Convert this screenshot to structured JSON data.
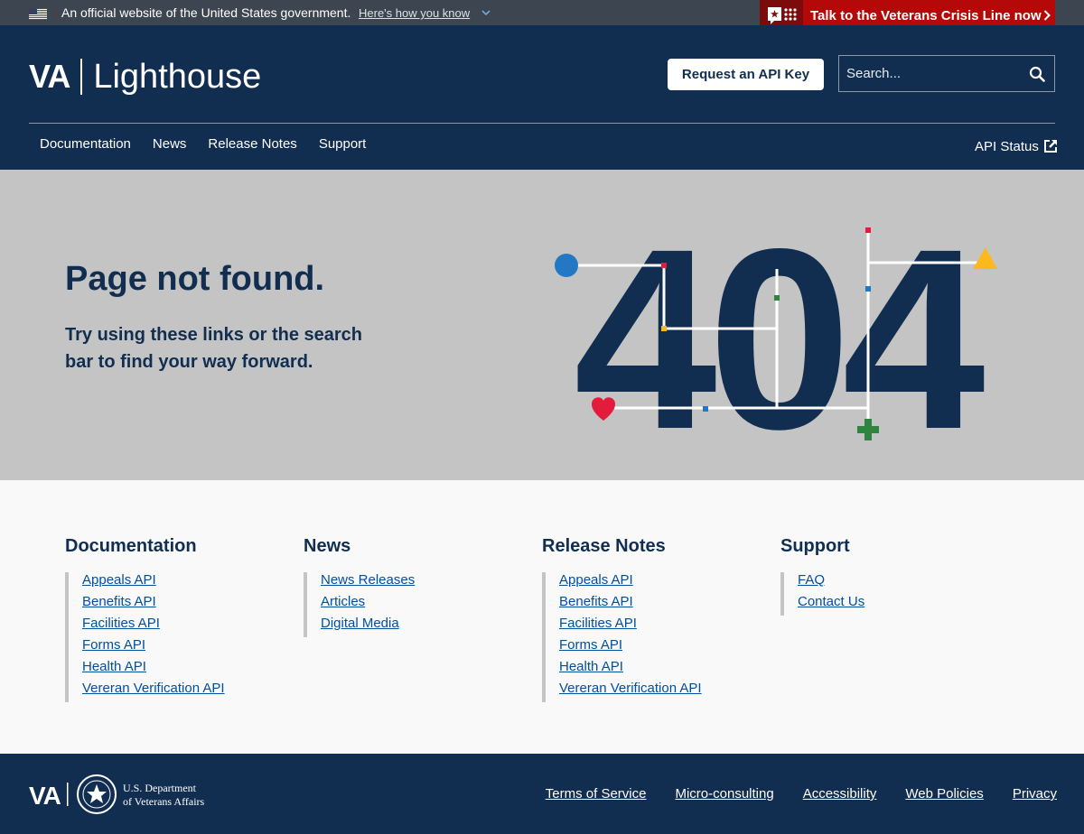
{
  "gov_banner": {
    "text": "An official website of the United States government.",
    "link": "Here's how you know"
  },
  "crisis": {
    "label": "Talk to the Veterans Crisis Line now"
  },
  "header": {
    "logo_va": "VA",
    "logo_name": "Lighthouse",
    "api_key_button": "Request an API Key",
    "search_placeholder": "Search...",
    "nav": [
      "Documentation",
      "News",
      "Release Notes",
      "Support"
    ],
    "api_status": "API Status"
  },
  "hero": {
    "title": "Page not found.",
    "subtitle": "Try using these links or the search bar to find your way forward.",
    "code": "404"
  },
  "footer_columns": [
    {
      "heading": "Documentation",
      "links": [
        "Appeals API",
        "Benefits API",
        "Facilities API",
        "Forms API",
        "Health API",
        "Vereran Verification API"
      ]
    },
    {
      "heading": "News",
      "links": [
        "News Releases",
        "Articles",
        "Digital Media"
      ]
    },
    {
      "heading": "Release Notes",
      "links": [
        "Appeals API",
        "Benefits API",
        "Facilities API",
        "Forms API",
        "Health API",
        "Vereran Verification API"
      ]
    },
    {
      "heading": "Support",
      "links": [
        "FAQ",
        "Contact Us"
      ]
    }
  ],
  "bottom": {
    "logo_va": "VA",
    "dept_line1": "U.S. Department",
    "dept_line2": "of Veterans Affairs",
    "links": [
      "Terms of Service",
      "Micro-consulting",
      "Accessibility",
      "Web Policies",
      "Privacy"
    ]
  },
  "colors": {
    "navy": "#112e51",
    "hero_bg": "#c4c4c4",
    "crisis_red": "#b50909",
    "link_blue": "#0050a0",
    "accent_blue": "#2378c3",
    "accent_red": "#e31c3d",
    "accent_yellow": "#fdb81e",
    "accent_green": "#2e8540"
  },
  "icons": [
    "us-flag-icon",
    "chevron-down-icon",
    "crisis-line-icon",
    "chevron-right-icon",
    "search-icon",
    "external-link-icon",
    "heart-icon",
    "plus-icon",
    "triangle-icon",
    "circle-icon",
    "va-seal-icon"
  ]
}
